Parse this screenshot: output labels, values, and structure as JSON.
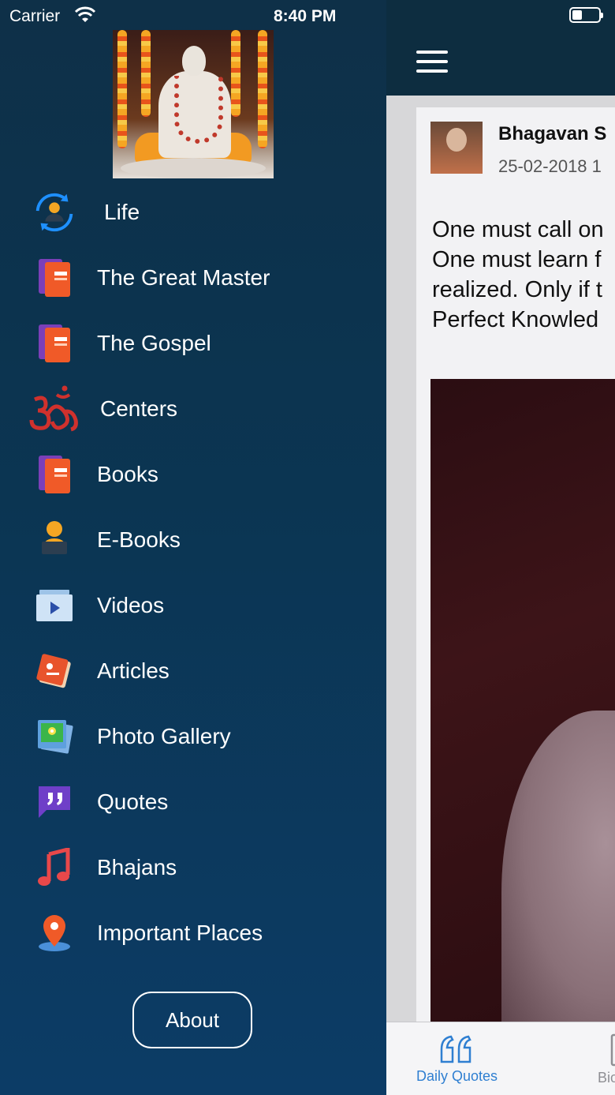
{
  "status_bar": {
    "carrier": "Carrier",
    "time": "8:40 PM"
  },
  "drawer": {
    "menu_items": [
      {
        "label": "Life",
        "icon": "life-cycle-icon"
      },
      {
        "label": "The Great Master",
        "icon": "book-icon"
      },
      {
        "label": "The Gospel",
        "icon": "book-icon"
      },
      {
        "label": "Centers",
        "icon": "om-icon"
      },
      {
        "label": "Books",
        "icon": "book-icon"
      },
      {
        "label": "E-Books",
        "icon": "reader-icon"
      },
      {
        "label": "Videos",
        "icon": "video-icon"
      },
      {
        "label": "Articles",
        "icon": "article-icon"
      },
      {
        "label": "Photo Gallery",
        "icon": "photo-gallery-icon"
      },
      {
        "label": "Quotes",
        "icon": "quote-icon"
      },
      {
        "label": "Bhajans",
        "icon": "music-note-icon"
      },
      {
        "label": "Important Places",
        "icon": "location-pin-icon"
      }
    ],
    "about_label": "About"
  },
  "post": {
    "author": "Bhagavan S",
    "date": "25-02-2018 1",
    "quote_text": "One must call on\nOne must learn f\nrealized. Only if t\nPerfect Knowled"
  },
  "tab_bar": {
    "tabs": [
      {
        "label": "Daily Quotes",
        "icon": "quote-marks-icon",
        "active": true
      },
      {
        "label": "Biogr",
        "icon": "biography-doc-icon",
        "active": false
      }
    ]
  },
  "colors": {
    "accent_blue": "#2f7fd1",
    "drawer_top": "#0e3048",
    "drawer_bottom": "#0c3c66",
    "navbar": "#0d2d40",
    "om_red": "#d0312d"
  }
}
